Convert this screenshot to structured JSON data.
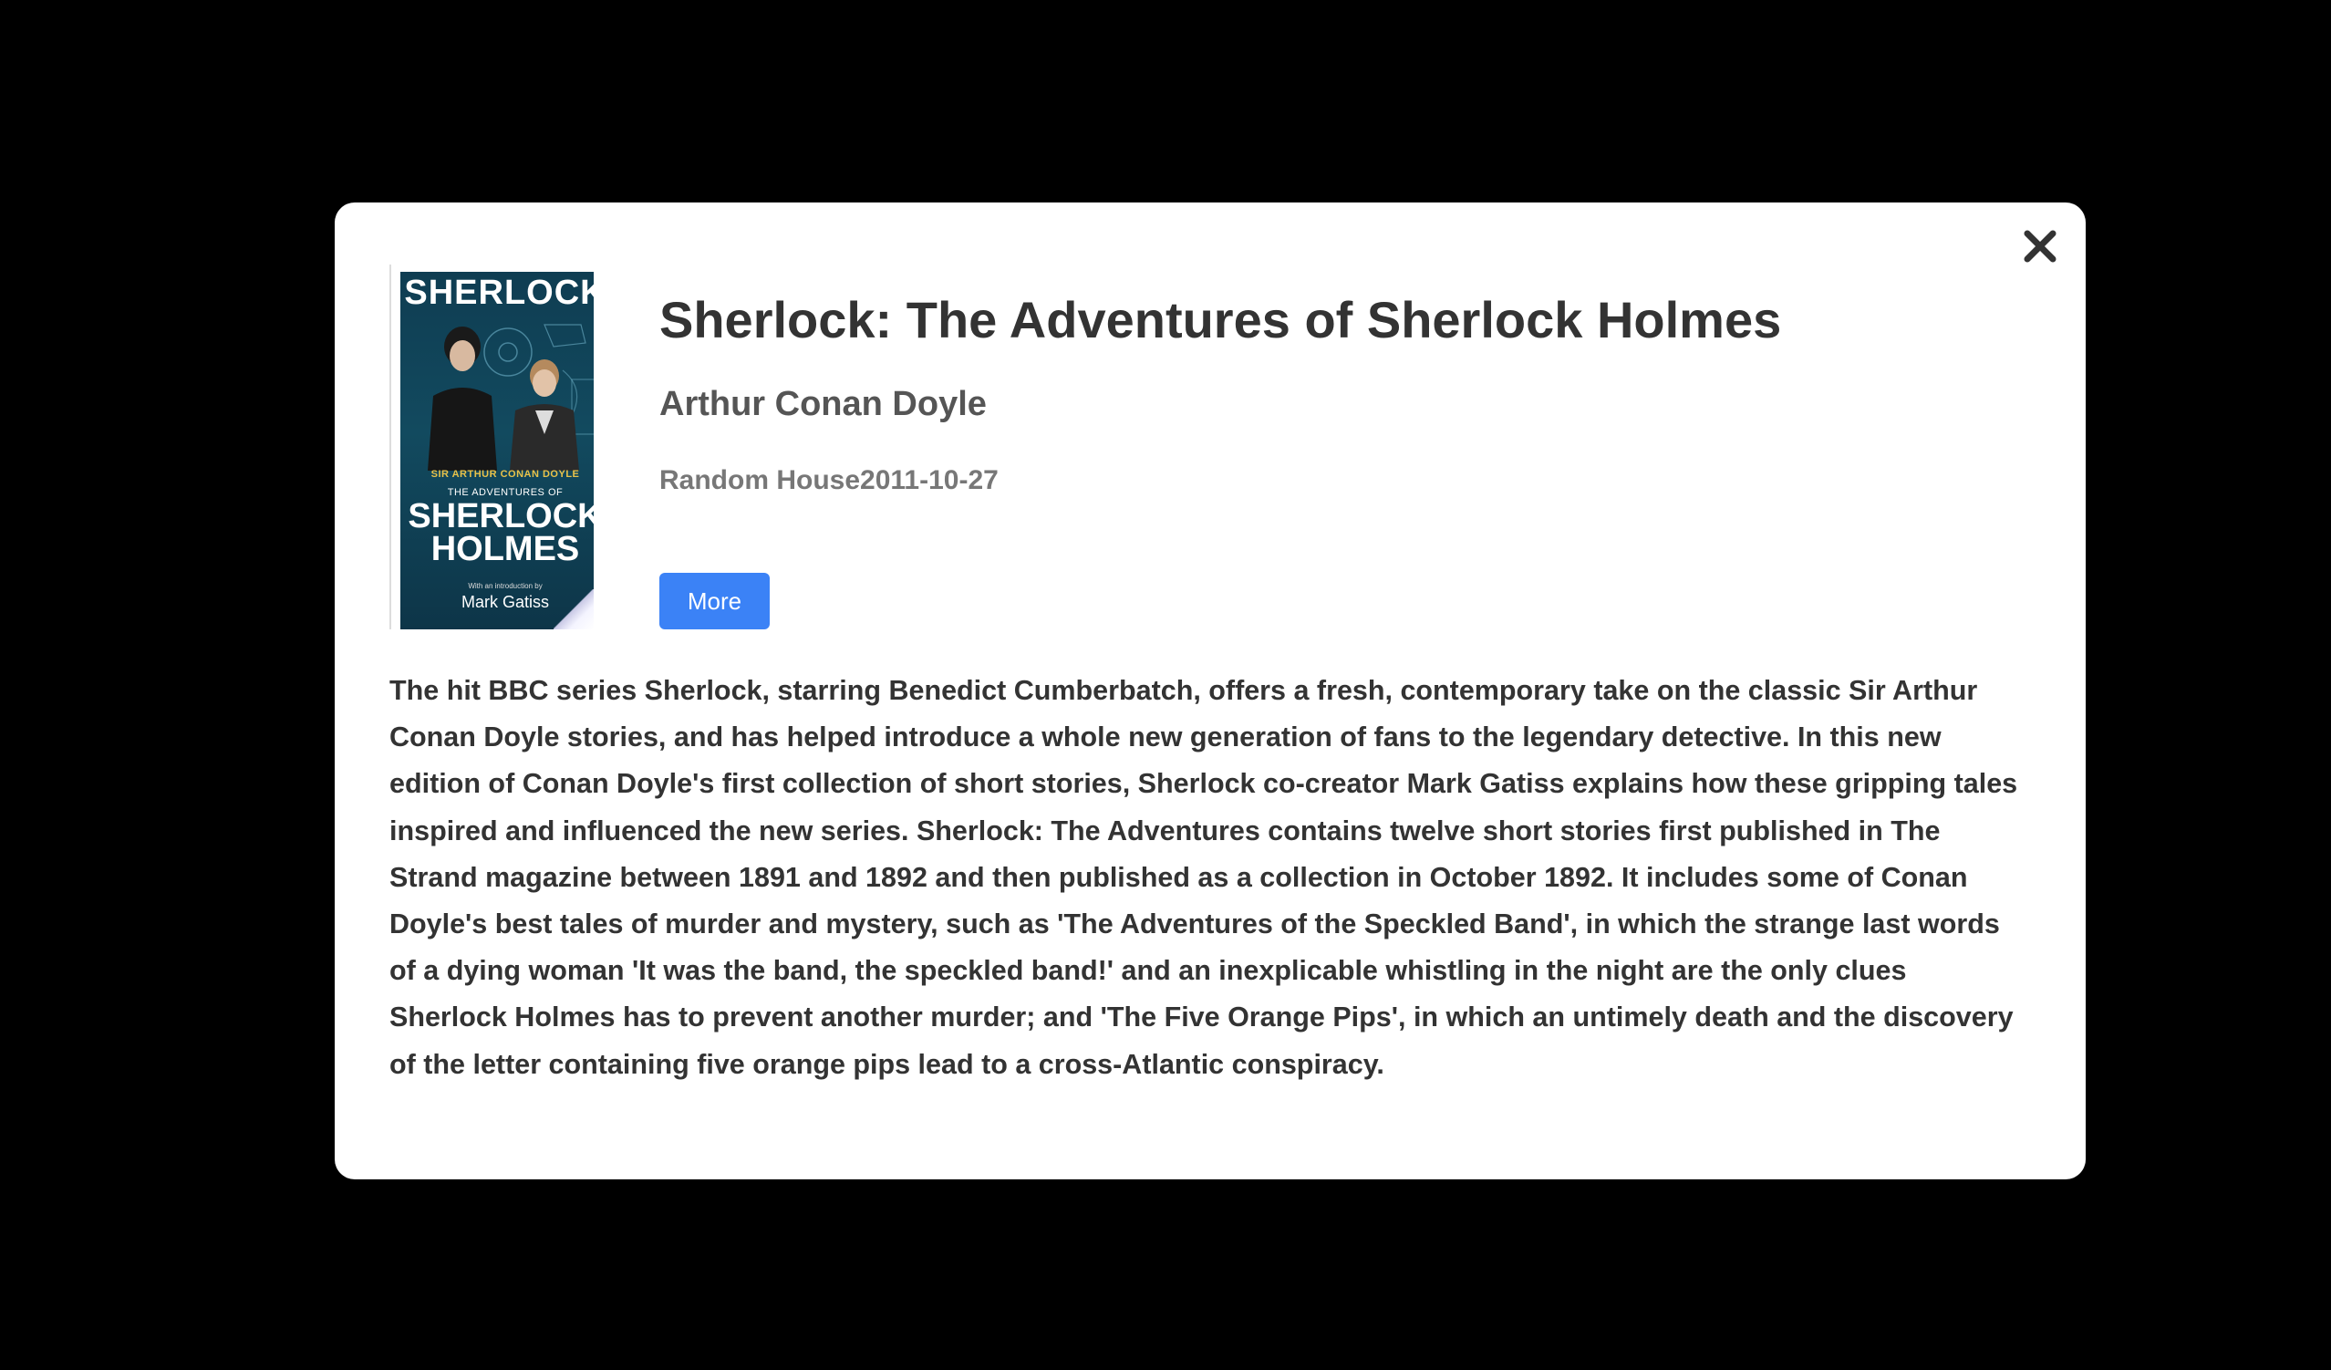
{
  "book": {
    "title": "Sherlock: The Adventures of Sherlock Holmes",
    "author": "Arthur Conan Doyle",
    "publisher_date": "Random House2011-10-27",
    "more_label": "More",
    "description": "The hit BBC series Sherlock, starring Benedict Cumberbatch, offers a fresh, contemporary take on the classic Sir Arthur Conan Doyle stories, and has helped introduce a whole new generation of fans to the legendary detective. In this new edition of Conan Doyle's first collection of short stories, Sherlock co-creator Mark Gatiss explains how these gripping tales inspired and influenced the new series. Sherlock: The Adventures contains twelve short stories first published in The Strand magazine between 1891 and 1892 and then published as a collection in October 1892. It includes some of Conan Doyle's best tales of murder and mystery, such as 'The Adventures of the Speckled Band', in which the strange last words of a dying woman 'It was the band, the speckled band!' and an inexplicable whistling in the night are the only clues Sherlock Holmes has to prevent another murder; and 'The Five Orange Pips', in which an untimely death and the discovery of the letter containing five orange pips lead to a cross-Atlantic conspiracy."
  },
  "cover": {
    "top_title": "SHERLOCK",
    "author_line": "SIR ARTHUR CONAN DOYLE",
    "sub_line": "THE ADVENTURES OF",
    "big_title_1": "SHERLOCK",
    "big_title_2": "HOLMES",
    "intro_line": "With an introduction by",
    "intro_name": "Mark Gatiss"
  },
  "icons": {
    "close": "close-icon"
  },
  "colors": {
    "backdrop": "#000000",
    "modal_bg": "#ffffff",
    "primary_button": "#3b82f6",
    "title_text": "#333333"
  }
}
